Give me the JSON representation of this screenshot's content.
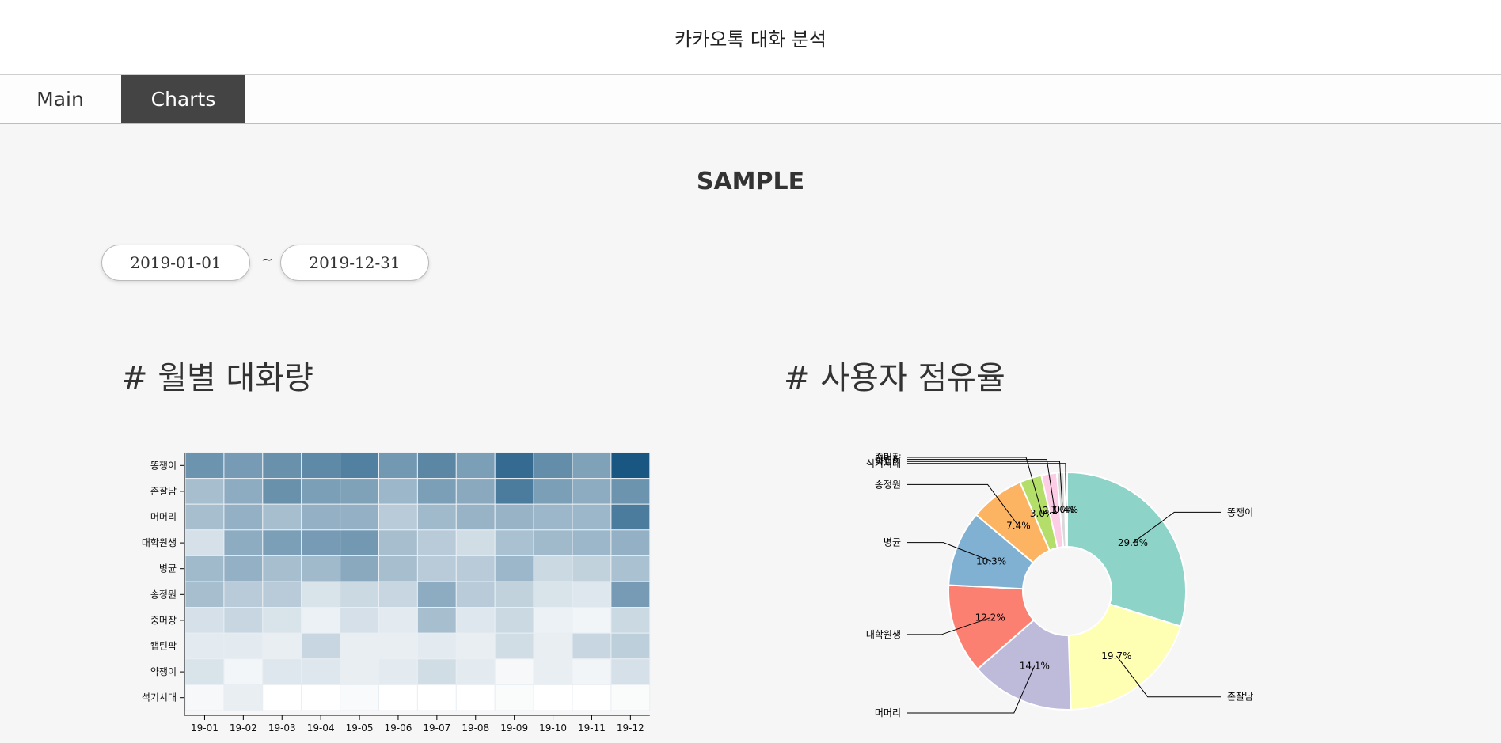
{
  "app": {
    "title": "카카오톡 대화 분석"
  },
  "tabs": [
    {
      "label": "Main"
    },
    {
      "label": "Charts"
    }
  ],
  "page": {
    "section_title": "SAMPLE"
  },
  "date_range": {
    "start": "2019-01-01",
    "separator": "~",
    "end": "2019-12-31"
  },
  "headings": {
    "heatmap": "# 월별 대화량",
    "pie": "# 사용자 점유율"
  },
  "chart_data": [
    {
      "type": "heatmap",
      "title": "# 월별 대화량",
      "x": [
        "19-01",
        "19-02",
        "19-03",
        "19-04",
        "19-05",
        "19-06",
        "19-07",
        "19-08",
        "19-09",
        "19-10",
        "19-11",
        "19-12"
      ],
      "y": [
        "똥쟁이",
        "존잘남",
        "머머리",
        "대학원생",
        "병균",
        "송정원",
        "중머장",
        "캡틴팍",
        "약쟁이",
        "석기시대"
      ],
      "values": [
        [
          0.62,
          0.58,
          0.64,
          0.68,
          0.74,
          0.6,
          0.7,
          0.56,
          0.86,
          0.66,
          0.54,
          0.98
        ],
        [
          0.38,
          0.48,
          0.64,
          0.56,
          0.54,
          0.42,
          0.56,
          0.5,
          0.76,
          0.56,
          0.48,
          0.62
        ],
        [
          0.38,
          0.46,
          0.38,
          0.46,
          0.46,
          0.3,
          0.4,
          0.44,
          0.44,
          0.42,
          0.42,
          0.76
        ],
        [
          0.18,
          0.48,
          0.56,
          0.58,
          0.6,
          0.38,
          0.3,
          0.2,
          0.36,
          0.4,
          0.42,
          0.46
        ],
        [
          0.4,
          0.46,
          0.38,
          0.4,
          0.5,
          0.38,
          0.3,
          0.3,
          0.42,
          0.22,
          0.26,
          0.36
        ],
        [
          0.38,
          0.3,
          0.3,
          0.16,
          0.22,
          0.24,
          0.48,
          0.3,
          0.26,
          0.16,
          0.14,
          0.58
        ],
        [
          0.18,
          0.24,
          0.16,
          0.08,
          0.18,
          0.12,
          0.38,
          0.14,
          0.22,
          0.08,
          0.06,
          0.22
        ],
        [
          0.12,
          0.12,
          0.1,
          0.24,
          0.1,
          0.1,
          0.12,
          0.1,
          0.2,
          0.1,
          0.24,
          0.28
        ],
        [
          0.16,
          0.05,
          0.14,
          0.14,
          0.1,
          0.12,
          0.2,
          0.12,
          0.04,
          0.1,
          0.06,
          0.18
        ],
        [
          0.04,
          0.1,
          0.0,
          0.0,
          0.03,
          0.0,
          0.0,
          0.0,
          0.02,
          0.0,
          0.0,
          0.02
        ]
      ],
      "color_low": "#ffffff",
      "color_high": "#14537e"
    },
    {
      "type": "pie",
      "title": "# 사용자 점유율",
      "donut": true,
      "slices": [
        {
          "label": "똥쟁이",
          "value": 29.8,
          "pct_label": "29.8%",
          "color": "#8dd3c7"
        },
        {
          "label": "존잘남",
          "value": 19.7,
          "pct_label": "19.7%",
          "color": "#ffffb3"
        },
        {
          "label": "머머리",
          "value": 14.1,
          "pct_label": "14.1%",
          "color": "#bebada"
        },
        {
          "label": "대학원생",
          "value": 12.2,
          "pct_label": "12.2%",
          "color": "#fb8072"
        },
        {
          "label": "병균",
          "value": 10.3,
          "pct_label": "10.3%",
          "color": "#80b1d3"
        },
        {
          "label": "송정원",
          "value": 7.4,
          "pct_label": "7.4%",
          "color": "#fdb462"
        },
        {
          "label": "중머장",
          "value": 3.0,
          "pct_label": "3.0%",
          "color": "#b3de69"
        },
        {
          "label": "캡틴팍",
          "value": 2.1,
          "pct_label": "2.1%",
          "color": "#fccde5"
        },
        {
          "label": "약쟁이",
          "value": 1.0,
          "pct_label": "1.0%",
          "color": "#d9d9d9"
        },
        {
          "label": "석기시대",
          "value": 0.4,
          "pct_label": "0.4%",
          "color": "#bc80bd"
        }
      ]
    }
  ]
}
